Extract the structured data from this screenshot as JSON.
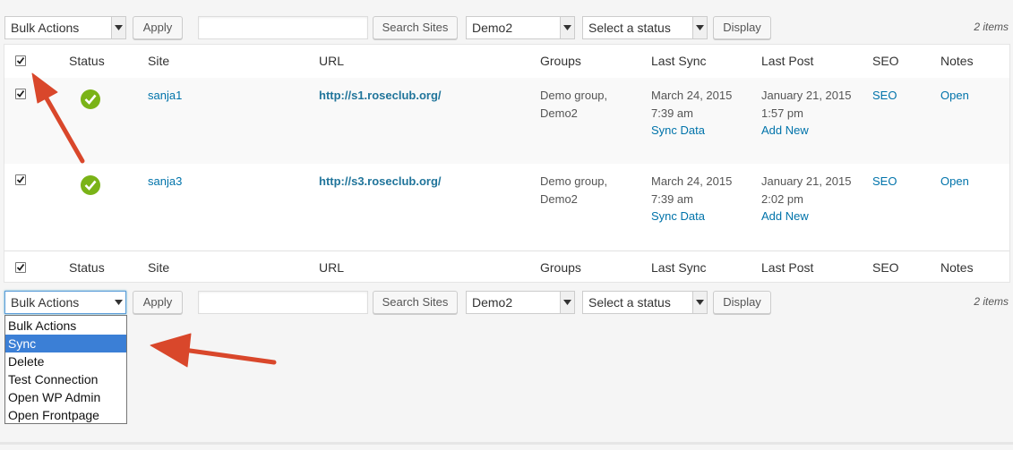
{
  "toolbar_top": {
    "bulk_action": "Bulk Actions",
    "apply": "Apply",
    "search_value": "",
    "search_button": "Search Sites",
    "group_filter": "Demo2",
    "status_filter": "Select a status",
    "display_button": "Display",
    "item_count": "2 items"
  },
  "toolbar_bottom": {
    "bulk_action": "Bulk Actions",
    "apply": "Apply",
    "search_value": "",
    "search_button": "Search Sites",
    "group_filter": "Demo2",
    "status_filter": "Select a status",
    "display_button": "Display",
    "item_count": "2 items"
  },
  "columns": [
    "Status",
    "Site",
    "URL",
    "Groups",
    "Last Sync",
    "Last Post",
    "SEO",
    "Notes"
  ],
  "rows": [
    {
      "checked": true,
      "status": "connected",
      "site": "sanja1",
      "url": "http://s1.roseclub.org/",
      "groups_line1": "Demo group,",
      "groups_line2": "Demo2",
      "last_sync_date": "March 24, 2015",
      "last_sync_time": "7:39 am",
      "sync_link": "Sync Data",
      "last_post_date": "January 21, 2015",
      "last_post_time": "1:57 pm",
      "add_new_link": "Add New",
      "seo": "SEO",
      "notes": "Open"
    },
    {
      "checked": true,
      "status": "connected",
      "site": "sanja3",
      "url": "http://s3.roseclub.org/",
      "groups_line1": "Demo group,",
      "groups_line2": "Demo2",
      "last_sync_date": "March 24, 2015",
      "last_sync_time": "7:39 am",
      "sync_link": "Sync Data",
      "last_post_date": "January 21, 2015",
      "last_post_time": "2:02 pm",
      "add_new_link": "Add New",
      "seo": "SEO",
      "notes": "Open"
    }
  ],
  "bulk_dropdown": {
    "options": [
      "Bulk Actions",
      "Sync",
      "Delete",
      "Test Connection",
      "Open WP Admin",
      "Open Frontpage"
    ],
    "highlighted": "Sync"
  },
  "colors": {
    "link": "#0073aa",
    "status_ok": "#7ab317",
    "annotation_arrow": "#d9472b",
    "dropdown_highlight": "#3b7fd6"
  }
}
